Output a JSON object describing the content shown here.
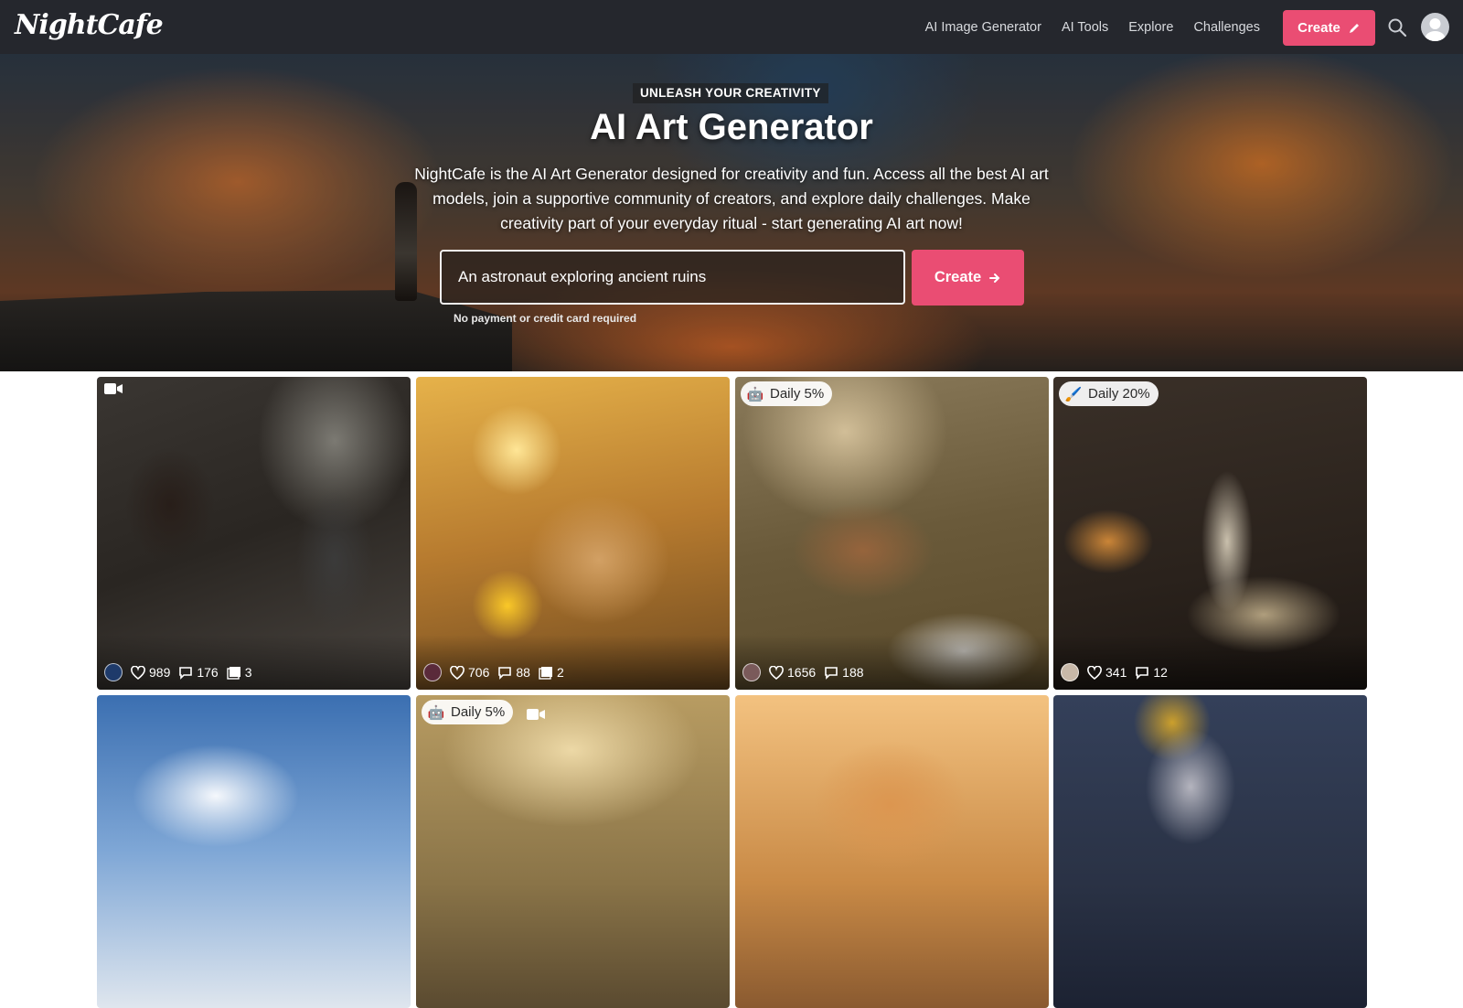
{
  "nav": {
    "logo": "NightCafe",
    "links": [
      "AI Image Generator",
      "AI Tools",
      "Explore",
      "Challenges"
    ],
    "create_label": "Create",
    "icons": {
      "create": "pencil-icon",
      "search": "search-icon",
      "avatar": "user-avatar"
    }
  },
  "hero": {
    "eyebrow": "UNLEASH YOUR CREATIVITY",
    "title": "AI Art Generator",
    "description": "NightCafe is the AI Art Generator designed for creativity and fun. Access all the best AI art models, join a supportive community of creators, and explore daily challenges. Make creativity part of your everyday ritual - start generating AI art now!",
    "prompt_value": "An astronaut exploring ancient ruins",
    "create_label": "Create",
    "note": "No payment or credit card required"
  },
  "colors": {
    "accent": "#ea4d73",
    "nav_bg": "#25272d"
  },
  "gallery": [
    {
      "badge": "",
      "video": true,
      "likes": "989",
      "comments": "176",
      "images": "3"
    },
    {
      "badge": "",
      "video": false,
      "likes": "706",
      "comments": "88",
      "images": "2"
    },
    {
      "badge": "Daily 5%",
      "badge_icon": "robot-icon",
      "video": false,
      "likes": "1656",
      "comments": "188",
      "images": ""
    },
    {
      "badge": "Daily 20%",
      "badge_icon": "paintbrush-icon",
      "video": false,
      "likes": "341",
      "comments": "12",
      "images": ""
    },
    {
      "badge": "",
      "video": false
    },
    {
      "badge": "Daily 5%",
      "badge_icon": "robot-icon",
      "video": true
    },
    {
      "badge": "",
      "video": false
    },
    {
      "badge": "",
      "video": false
    }
  ]
}
